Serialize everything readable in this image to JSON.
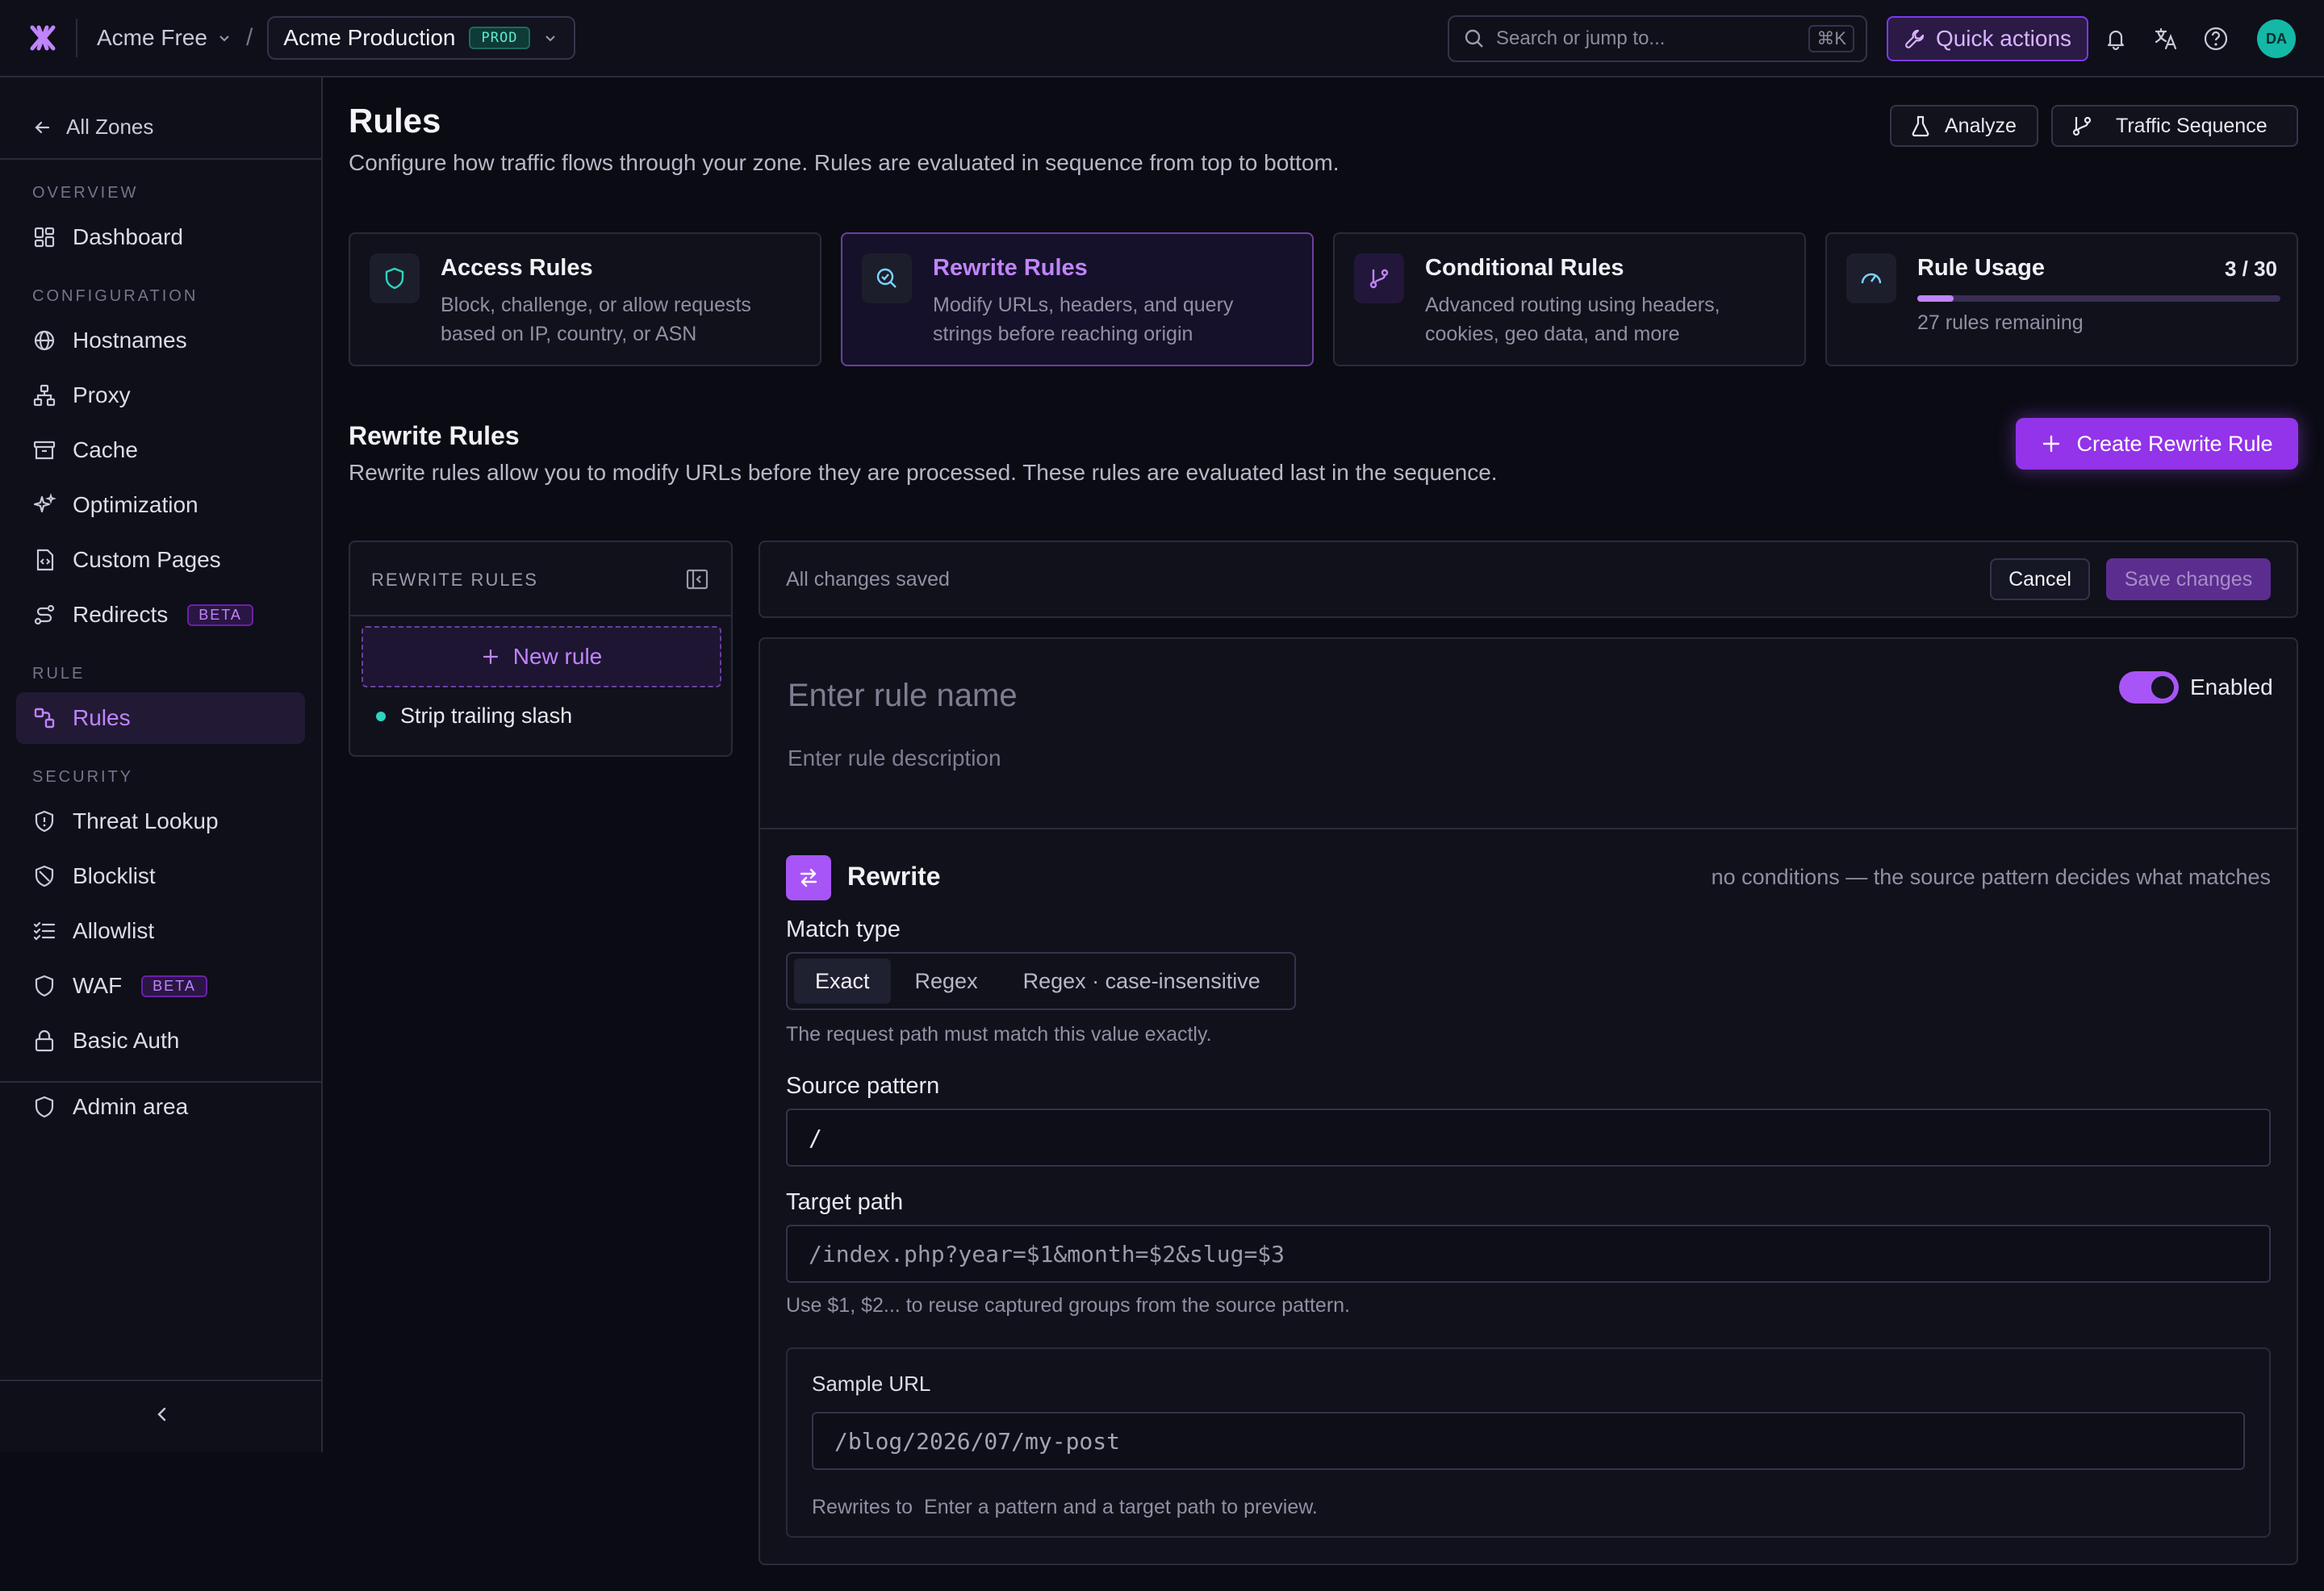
{
  "topbar": {
    "org": "Acme Free",
    "separator": "/",
    "environment": "Acme Production",
    "env_badge": "PROD",
    "search_placeholder": "Search or jump to...",
    "search_shortcut": "⌘K",
    "quick_actions": "Quick actions",
    "avatar": "DA"
  },
  "sidebar": {
    "back": "All Zones",
    "sections": {
      "overview": "OVERVIEW",
      "configuration": "CONFIGURATION",
      "rule": "RULE",
      "security": "SECURITY"
    },
    "items": {
      "dashboard": "Dashboard",
      "hostnames": "Hostnames",
      "proxy": "Proxy",
      "cache": "Cache",
      "optimization": "Optimization",
      "custom_pages": "Custom Pages",
      "redirects": "Redirects",
      "rules": "Rules",
      "threat_lookup": "Threat Lookup",
      "blocklist": "Blocklist",
      "allowlist": "Allowlist",
      "waf": "WAF",
      "basic_auth": "Basic Auth",
      "admin_area": "Admin area"
    },
    "beta": "BETA"
  },
  "page": {
    "title": "Rules",
    "subtitle": "Configure how traffic flows through your zone. Rules are evaluated in sequence from top to bottom.",
    "analyze": "Analyze",
    "traffic_sequence": "Traffic Sequence"
  },
  "cards": {
    "access": {
      "title": "Access Rules",
      "desc": "Block, challenge, or allow requests based on IP, country, or ASN"
    },
    "rewrite": {
      "title": "Rewrite Rules",
      "desc": "Modify URLs, headers, and query strings before reaching origin"
    },
    "conditional": {
      "title": "Conditional Rules",
      "desc": "Advanced routing using headers, cookies, geo data, and more"
    },
    "usage": {
      "title": "Rule Usage",
      "value": "3 / 30",
      "used": 3,
      "limit": 30,
      "remaining": "27 rules remaining"
    }
  },
  "section": {
    "title": "Rewrite Rules",
    "desc": "Rewrite rules allow you to modify URLs before they are processed. These rules are evaluated last in the sequence.",
    "create": "Create Rewrite Rule"
  },
  "rules_list": {
    "header": "REWRITE RULES",
    "new_rule": "New rule",
    "items": [
      "Strip trailing slash"
    ]
  },
  "savebar": {
    "status": "All changes saved",
    "cancel": "Cancel",
    "save": "Save changes"
  },
  "editor": {
    "name_placeholder": "Enter rule name",
    "desc_placeholder": "Enter rule description",
    "enabled": "Enabled",
    "rewrite_title": "Rewrite",
    "rewrite_note": "no conditions — the source pattern decides what matches",
    "match_type_label": "Match type",
    "match_types": [
      "Exact",
      "Regex",
      "Regex · case-insensitive"
    ],
    "match_hint": "The request path must match this value exactly.",
    "source_label": "Source pattern",
    "source_value": "/",
    "target_label": "Target path",
    "target_placeholder": "/index.php?year=$1&month=$2&slug=$3",
    "target_hint": "Use $1, $2... to reuse captured groups from the source pattern.",
    "sample_label": "Sample URL",
    "sample_placeholder": "/blog/2026/07/my-post",
    "rewrites_to": "Rewrites to",
    "rewrites_preview": "Enter a pattern and a target path to preview."
  },
  "colors": {
    "accent": "#a855f7",
    "teal": "#2dd4bf",
    "background": "#0b0b14"
  }
}
